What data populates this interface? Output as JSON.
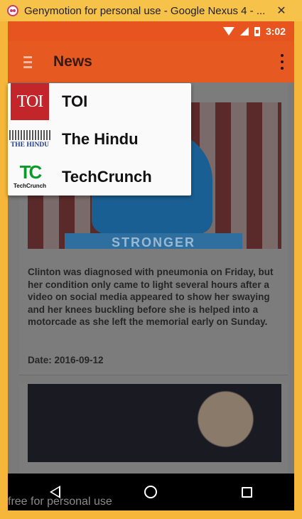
{
  "window": {
    "title": "Genymotion for personal use - Google Nexus 4 - ...",
    "close_icon": "close-icon"
  },
  "status_bar": {
    "time": "3:02"
  },
  "app_bar": {
    "title": "News"
  },
  "content": {
    "card1": {
      "image_text": "STRONGER",
      "description": "Clinton was diagnosed with pneumonia on Friday, but her condition only came to light several hours after a video on social media appeared to show her swaying and her knees buckling before she is helped into a motorcade as she left the memorial early on Sunday.",
      "date": "Date: 2016-09-12"
    }
  },
  "dropdown": {
    "items": [
      {
        "label": "TOI",
        "logo_text": "TOI"
      },
      {
        "label": "The Hindu",
        "logo_text": "THE HINDU"
      },
      {
        "label": "TechCrunch",
        "logo_glyph": "TC",
        "logo_text": "TechCrunch"
      }
    ]
  },
  "watermark": "free for personal use"
}
